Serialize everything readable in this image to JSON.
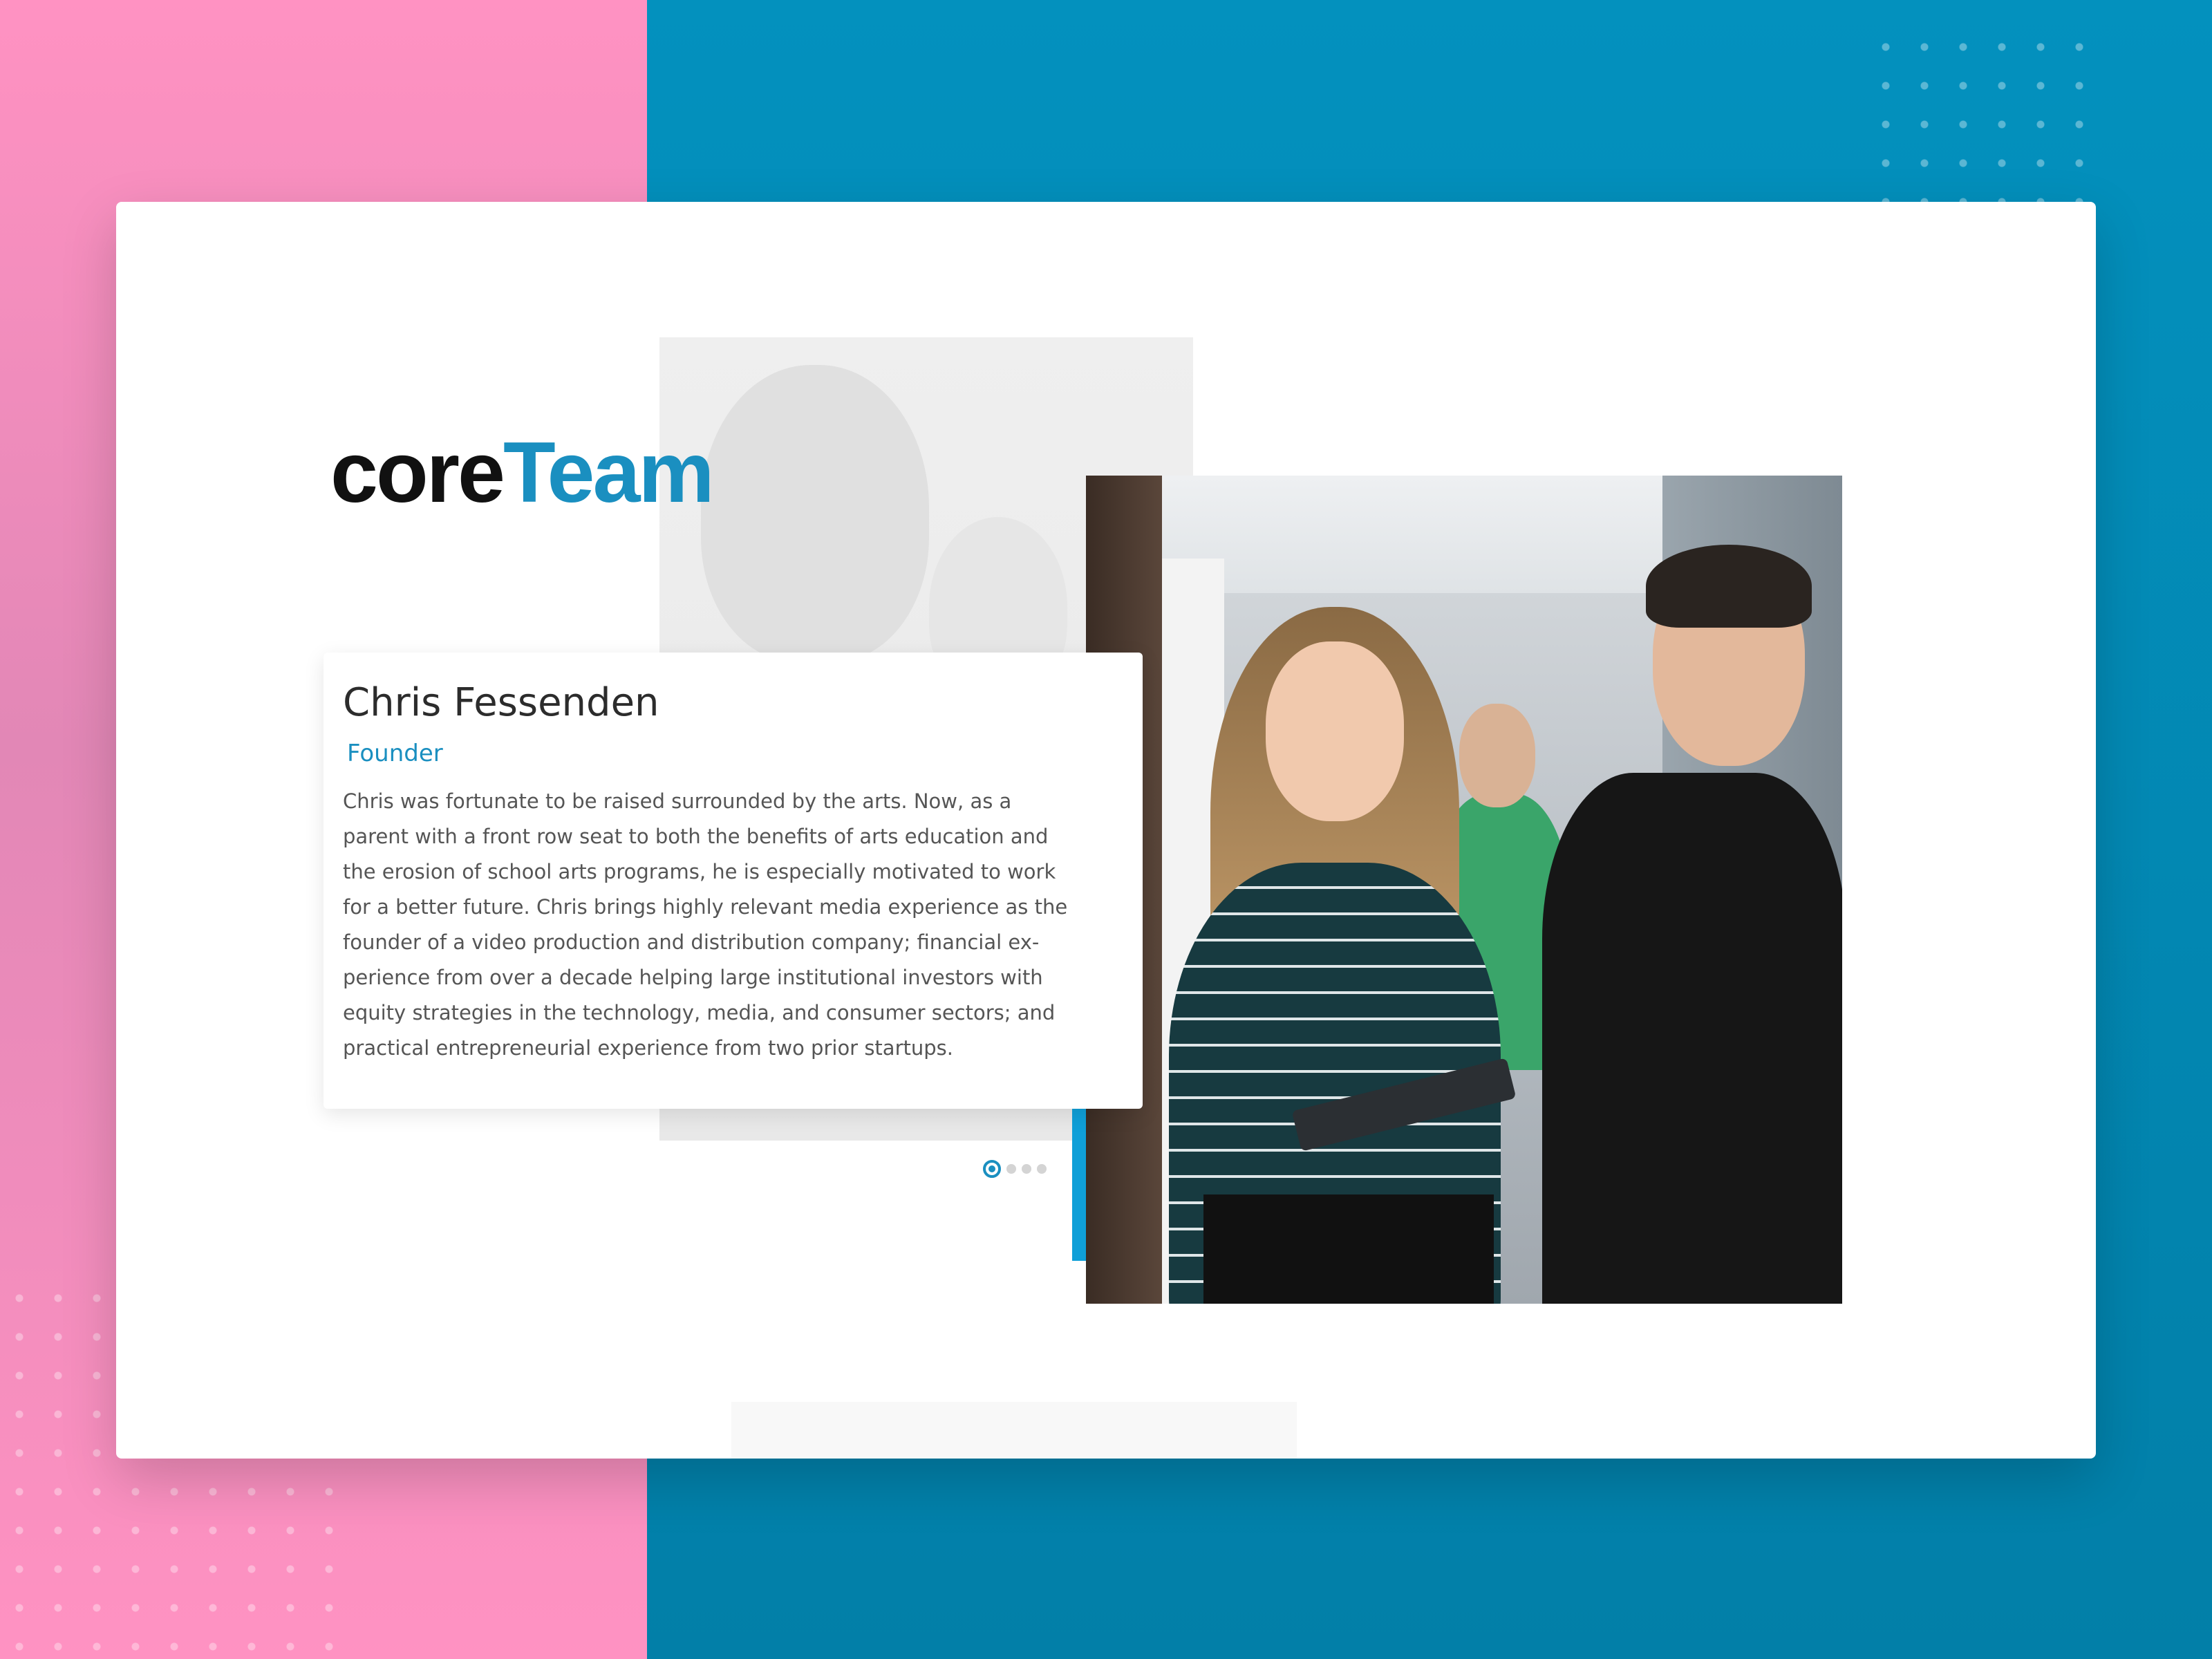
{
  "logo": {
    "part1": "core",
    "part2": "Team"
  },
  "profile": {
    "name": "Chris Fessenden",
    "role": "Founder",
    "bio_lines": [
      "Chris was fortunate to be raised surrounded by the arts. Now, as a",
      "parent with a front row seat to both the benefits of arts education and",
      "the erosion of school arts programs, he is especially motivated to work",
      "for a better future. Chris brings highly relevant media experience as the",
      "founder of a video production and distribution company; financial ex-",
      "perience from over a decade helping large institutional investors with",
      "equity strategies in the technology, media, and consumer sectors; and",
      "practical entrepreneurial experience from two prior startups."
    ]
  },
  "pager": {
    "count": 4,
    "active_index": 0
  },
  "colors": {
    "accent": "#1a8fc0",
    "pink": "#ff92c2",
    "blue": "#0290bf"
  }
}
